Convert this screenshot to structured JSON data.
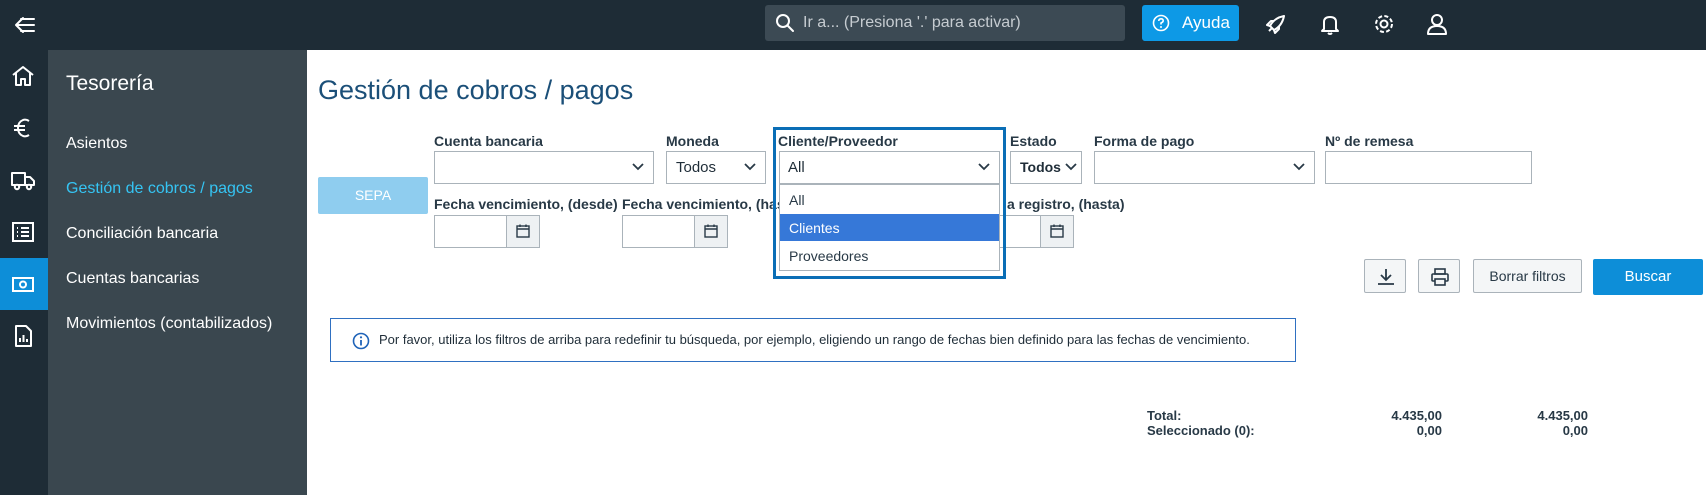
{
  "topbar": {
    "search_placeholder": "Ir a... (Presiona '.' para activar)",
    "help_label": "Ayuda"
  },
  "rail": {
    "items": [
      "home-icon",
      "euro-icon",
      "truck-icon",
      "list-icon",
      "cash-icon",
      "report-icon"
    ],
    "active_item": "cash-icon"
  },
  "sidebar": {
    "title": "Tesorería",
    "items": [
      {
        "label": "Asientos"
      },
      {
        "label": "Gestión de cobros / pagos"
      },
      {
        "label": "Conciliación bancaria"
      },
      {
        "label": "Cuentas bancarias"
      },
      {
        "label": "Movimientos (contabilizados)"
      }
    ],
    "active_label": "Gestión de cobros / pagos"
  },
  "main": {
    "title": "Gestión de cobros / pagos",
    "sepa_label": "SEPA",
    "filters": {
      "cuenta_bancaria": {
        "label": "Cuenta bancaria",
        "value": ""
      },
      "moneda": {
        "label": "Moneda",
        "value": "Todos"
      },
      "cliente_proveedor": {
        "label": "Cliente/Proveedor",
        "value": "All"
      },
      "estado": {
        "label": "Estado",
        "value": "Todos"
      },
      "forma_pago": {
        "label": "Forma de pago",
        "value": ""
      },
      "remesa": {
        "label": "Nº de remesa",
        "value": ""
      },
      "fecha_desde": {
        "label": "Fecha vencimiento, (desde)"
      },
      "fecha_hasta": {
        "label": "Fecha vencimiento, (has"
      },
      "registro_hasta": {
        "label": "a registro, (hasta)"
      }
    },
    "dropdown_options": [
      "All",
      "Clientes",
      "Proveedores"
    ],
    "dropdown_highlighted": "Clientes",
    "buttons": {
      "borrar": "Borrar filtros",
      "buscar": "Buscar"
    },
    "info_message": "Por favor, utiliza los filtros de arriba para redefinir tu búsqueda, por ejemplo, eligiendo un rango de fechas bien definido para las fechas de vencimiento.",
    "totals": {
      "total_label": "Total:",
      "selected_label": "Seleccionado (0):",
      "total_col1": "4.435,00",
      "total_col2": "4.435,00",
      "selected_col1": "0,00",
      "selected_col2": "0,00"
    }
  },
  "colors": {
    "topbar_bg": "#1e2c36",
    "sidebar_bg": "#3a474f",
    "accent": "#0d8ed8",
    "active_nav_text": "#35c4f3",
    "title_blue": "#1b4f78",
    "dropdown_highlight": "#3678d8"
  }
}
